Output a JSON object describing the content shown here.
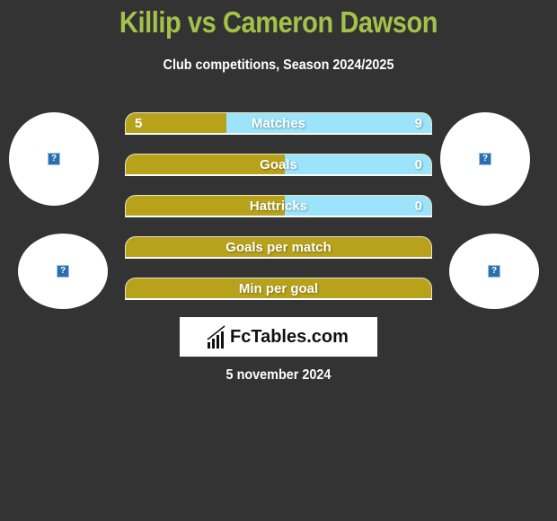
{
  "header": {
    "title": "Killip vs Cameron Dawson",
    "subtitle": "Club competitions, Season 2024/2025"
  },
  "players": {
    "left": {
      "name": "Killip",
      "avatar_icon": "image-placeholder-icon",
      "club_icon": "image-placeholder-icon"
    },
    "right": {
      "name": "Cameron Dawson",
      "avatar_icon": "image-placeholder-icon",
      "club_icon": "image-placeholder-icon"
    }
  },
  "colors": {
    "left": "#b9a21b",
    "right": "#9be4fb",
    "title": "#a4c14a",
    "background": "#333333"
  },
  "stats": [
    {
      "label": "Matches",
      "left": "5",
      "right": "9",
      "left_share": 0.33
    },
    {
      "label": "Goals",
      "left": "",
      "right": "0",
      "left_share": 0.52
    },
    {
      "label": "Hattricks",
      "left": "",
      "right": "0",
      "left_share": 0.52
    },
    {
      "label": "Goals per match",
      "left": "",
      "right": "",
      "left_share": 1.0
    },
    {
      "label": "Min per goal",
      "left": "",
      "right": "",
      "left_share": 1.0
    }
  ],
  "logo": {
    "text": "FcTables.com",
    "icon": "bar-chart-icon"
  },
  "date": "5 november 2024"
}
